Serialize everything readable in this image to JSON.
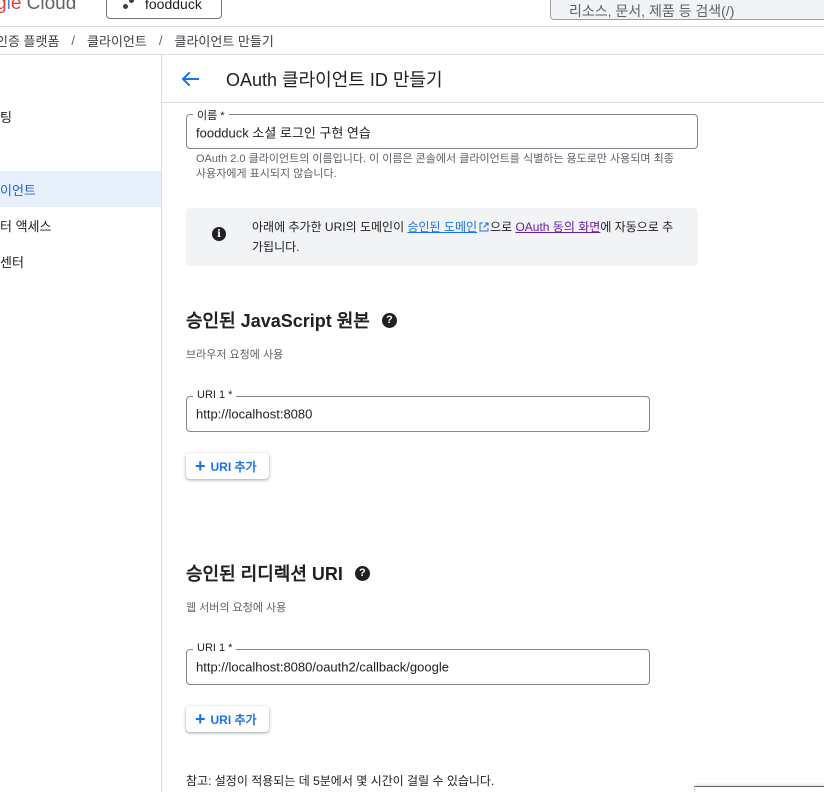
{
  "topbar": {
    "logo_text_parts": [
      "g",
      "l",
      "e",
      " Cloud"
    ],
    "project_name": "foodduck",
    "search_placeholder": "리소스, 문서, 제품 등 검색(/)"
  },
  "breadcrumb": [
    "인증 플랫폼",
    "클라이언트",
    "클라이언트 만들기"
  ],
  "breadcrumb_sep": "/",
  "sidebar": {
    "items": [
      {
        "label": "팅",
        "active": false
      },
      {
        "label": "이언트",
        "active": true
      },
      {
        "label": "터 액세스",
        "active": false
      },
      {
        "label": "센터",
        "active": false
      }
    ]
  },
  "header": {
    "title": "OAuth 클라이언트 ID 만들기"
  },
  "name_field": {
    "label": "이름 *",
    "value": "foodduck 소셜 로그인 구현 연습",
    "helper": "OAuth 2.0 클라이언트의 이름입니다. 이 이름은 콘솔에서 클라이언트를 식별하는 용도로만 사용되며 최종 사용자에게 표시되지 않습니다."
  },
  "info": {
    "text_before": "아래에 추가한 URI의 도메인이 ",
    "link1": "승인된 도메인",
    "text_middle": "으로 ",
    "link2": "OAuth 동의 화면",
    "text_after": "에 자동으로 추가됩니다."
  },
  "js_origins": {
    "title": "승인된 JavaScript 원본",
    "subtitle": "브라우저 요청에 사용",
    "uri_label": "URI 1 *",
    "uri_value": "http://localhost:8080",
    "add_label": "URI 추가"
  },
  "redirect_uris": {
    "title": "승인된 리디렉션 URI",
    "subtitle": "웹 서버의 요청에 사용",
    "uri_label": "URI 1 *",
    "uri_value": "http://localhost:8080/oauth2/callback/google",
    "add_label": "URI 추가"
  },
  "note": "참고: 설정이 적용되는 데 5분에서 몇 시간이 걸릴 수 있습니다.",
  "colors": {
    "accent": "#1a73e8",
    "visited_link": "#681da8",
    "active_nav_bg": "#e8f0fe",
    "info_bg": "#f1f3f4"
  }
}
